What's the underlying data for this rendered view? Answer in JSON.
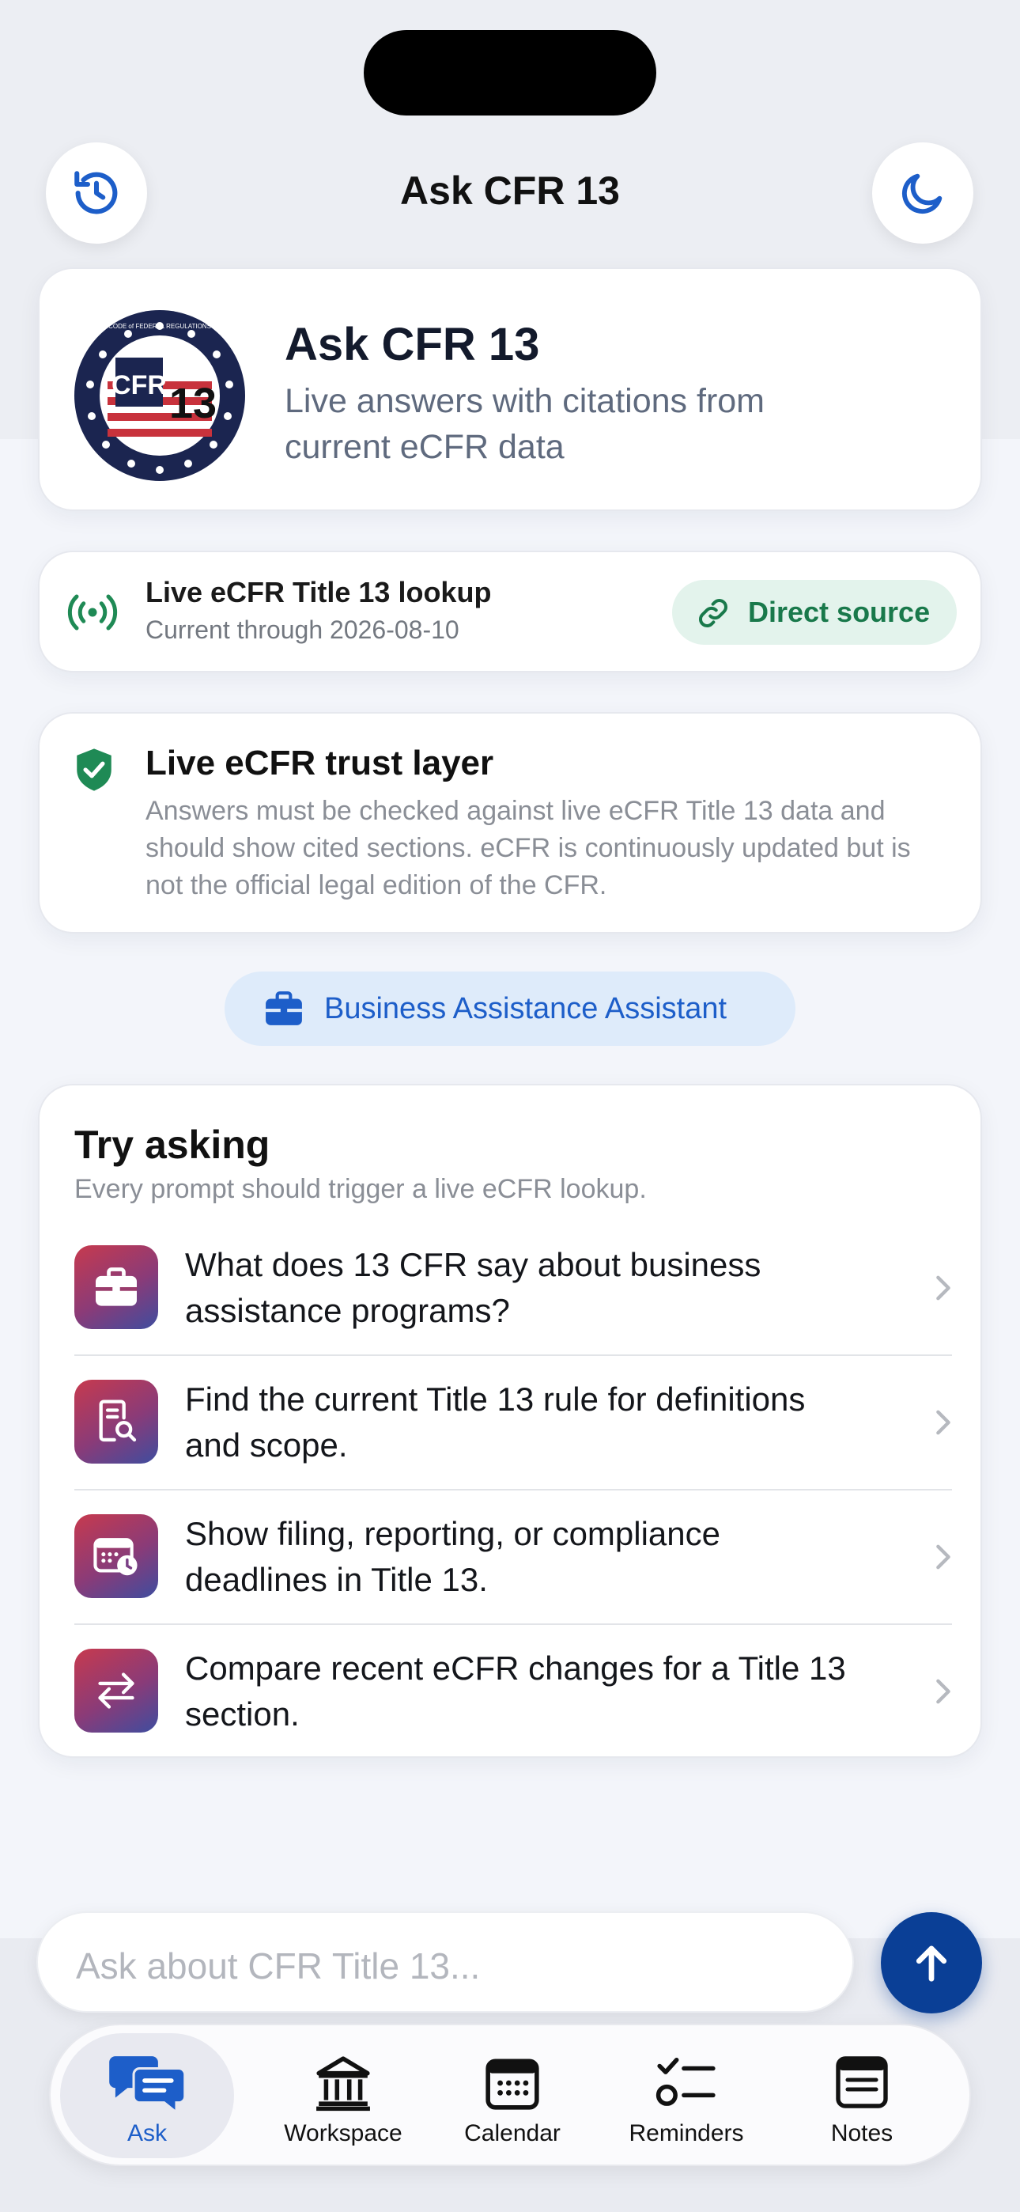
{
  "colors": {
    "accent": "#1d5ec9",
    "send": "#0a3f96",
    "success": "#19794b"
  },
  "nav": {
    "title": "Ask CFR 13",
    "left_icon": "history-icon",
    "right_icon": "moon-icon"
  },
  "hero": {
    "title": "Ask CFR 13",
    "subtitle": "Live answers with citations from current eCFR data",
    "seal": {
      "top_text": "CODE of FEDERAL REGULATIONS",
      "label": "CFR",
      "number": "13"
    }
  },
  "lookup": {
    "title": "Live eCFR Title 13 lookup",
    "subtitle": "Current through 2026-08-10",
    "source_label": "Direct source"
  },
  "trust": {
    "title": "Live eCFR trust layer",
    "body": "Answers must be checked against live eCFR Title 13 data and should show cited sections. eCFR is continuously updated but is not the official legal edition of the CFR."
  },
  "assistant": {
    "label": "Business Assistance Assistant"
  },
  "try_asking": {
    "title": "Try asking",
    "subtitle": "Every prompt should trigger a live eCFR lookup.",
    "prompts": [
      {
        "text": "What does 13 CFR say about business assistance programs?",
        "icon": "briefcase-icon"
      },
      {
        "text": "Find the current Title 13 rule for definitions and scope.",
        "icon": "document-search-icon"
      },
      {
        "text": "Show filing, reporting, or compliance deadlines in Title 13.",
        "icon": "calendar-clock-icon"
      },
      {
        "text": "Compare recent eCFR changes for a Title 13 section.",
        "icon": "arrows-swap-icon"
      }
    ]
  },
  "input": {
    "placeholder": "Ask about CFR Title 13..."
  },
  "tabs": [
    {
      "label": "Ask",
      "icon": "chat-bubbles-icon",
      "active": true
    },
    {
      "label": "Workspace",
      "icon": "bank-icon",
      "active": false
    },
    {
      "label": "Calendar",
      "icon": "calendar-icon",
      "active": false
    },
    {
      "label": "Reminders",
      "icon": "checklist-icon",
      "active": false
    },
    {
      "label": "Notes",
      "icon": "notes-icon",
      "active": false
    }
  ]
}
